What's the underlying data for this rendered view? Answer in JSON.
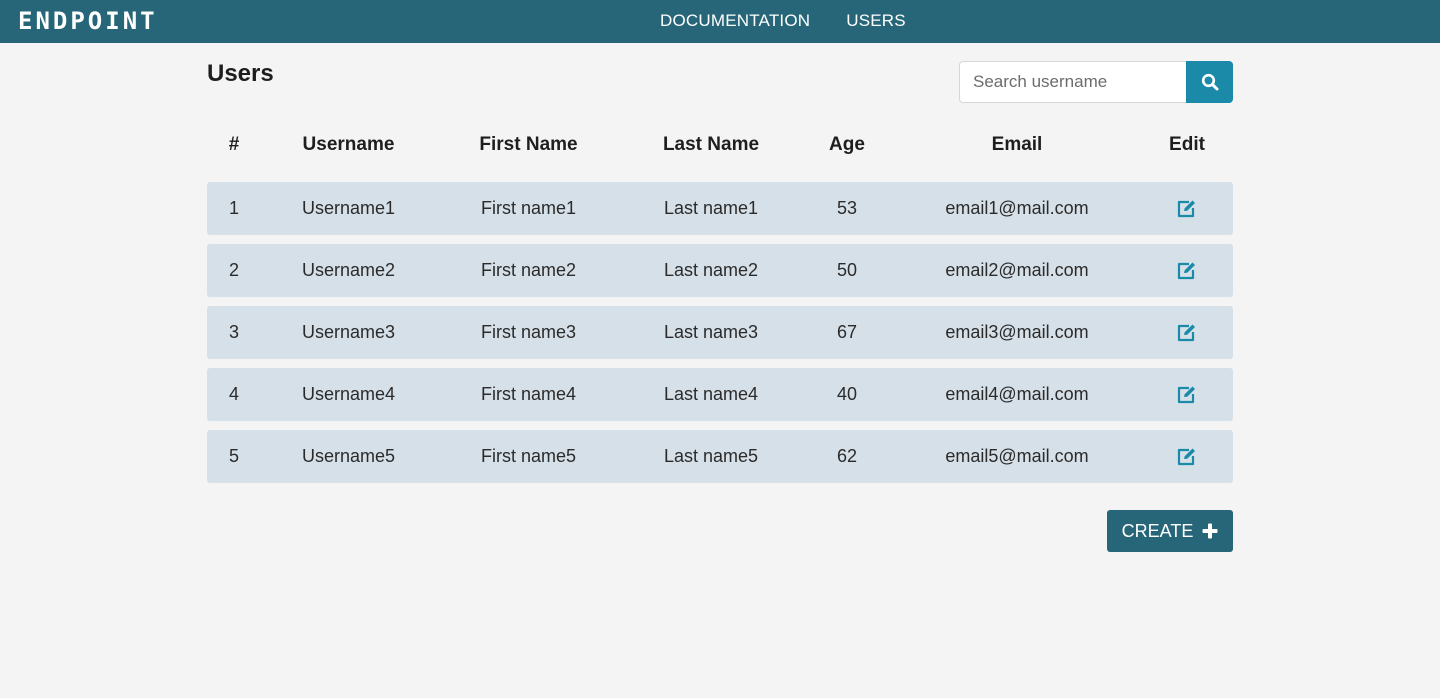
{
  "navbar": {
    "brand": "ENDPOINT",
    "links": [
      {
        "label": "DOCUMENTATION"
      },
      {
        "label": "USERS"
      }
    ]
  },
  "page": {
    "title": "Users"
  },
  "search": {
    "placeholder": "Search username",
    "value": "",
    "icon": "search-icon"
  },
  "table": {
    "headers": [
      "#",
      "Username",
      "First Name",
      "Last Name",
      "Age",
      "Email",
      "Edit"
    ],
    "rows": [
      {
        "id": "1",
        "username": "Username1",
        "first_name": "First name1",
        "last_name": "Last name1",
        "age": "53",
        "email": "email1@mail.com"
      },
      {
        "id": "2",
        "username": "Username2",
        "first_name": "First name2",
        "last_name": "Last name2",
        "age": "50",
        "email": "email2@mail.com"
      },
      {
        "id": "3",
        "username": "Username3",
        "first_name": "First name3",
        "last_name": "Last name3",
        "age": "67",
        "email": "email3@mail.com"
      },
      {
        "id": "4",
        "username": "Username4",
        "first_name": "First name4",
        "last_name": "Last name4",
        "age": "40",
        "email": "email4@mail.com"
      },
      {
        "id": "5",
        "username": "Username5",
        "first_name": "First name5",
        "last_name": "Last name5",
        "age": "62",
        "email": "email5@mail.com"
      }
    ],
    "edit_icon": "edit-icon"
  },
  "actions": {
    "create_label": "CREATE",
    "create_icon": "plus-icon"
  },
  "colors": {
    "navbar": "#266678",
    "accent": "#1a8aa8",
    "row_background": "#d6e0e8",
    "page_background": "#f4f4f4"
  }
}
